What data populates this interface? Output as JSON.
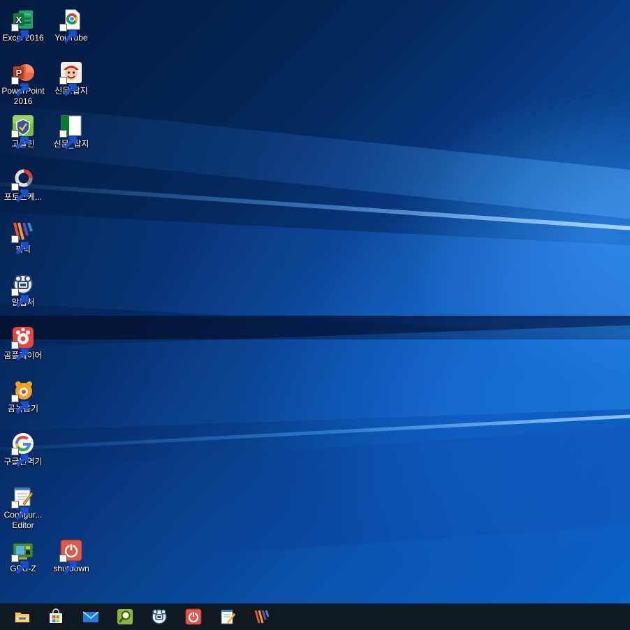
{
  "desktop": {
    "icons": [
      {
        "label": "Excel 2016"
      },
      {
        "label": "YouTube"
      },
      {
        "label": "PowerPoint 2016"
      },
      {
        "label": "신문.잡지"
      },
      {
        "label": "고클린"
      },
      {
        "label": "신문_잡지"
      },
      {
        "label": "포토스케..."
      },
      {
        "label": "픽픽"
      },
      {
        "label": "알캡처"
      },
      {
        "label": "곰플레이어"
      },
      {
        "label": "곰녹음기"
      },
      {
        "label": "구글번역기"
      },
      {
        "label": "Configur... Editor"
      },
      {
        "label": "GPU-Z"
      },
      {
        "label": "shutdown"
      }
    ]
  },
  "taskbar": {
    "items": [
      {
        "icon": "file-explorer-icon"
      },
      {
        "icon": "store-icon"
      },
      {
        "icon": "mail-icon"
      },
      {
        "icon": "search-app-icon"
      },
      {
        "icon": "alcapture-icon"
      },
      {
        "icon": "shutdown-icon"
      },
      {
        "icon": "notepad-icon"
      },
      {
        "icon": "picpick-icon"
      }
    ]
  },
  "colors": {
    "accent": "#0b63c8",
    "taskbar": "#101820"
  }
}
